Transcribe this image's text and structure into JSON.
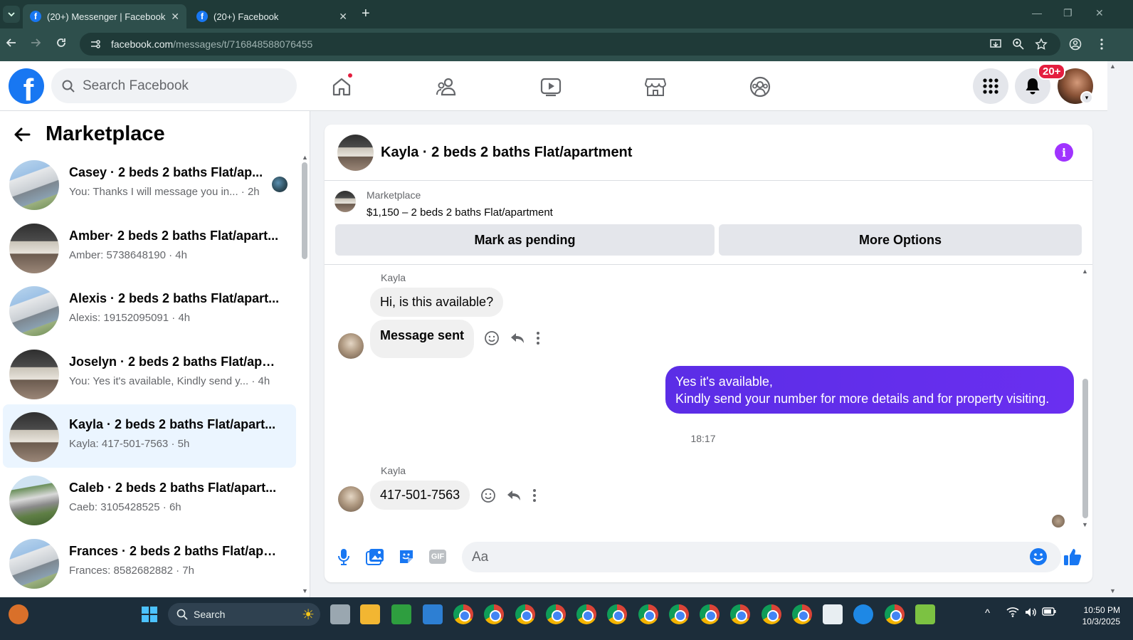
{
  "browser": {
    "tabs": [
      {
        "title": "(20+) Messenger | Facebook",
        "active": true
      },
      {
        "title": "(20+) Facebook",
        "active": false
      }
    ],
    "url_host": "facebook.com",
    "url_path": "/messages/t/716848588076455"
  },
  "fb_header": {
    "logo": "f",
    "search_placeholder": "Search Facebook",
    "notification_badge": "20+",
    "nav_icons": [
      "home-icon",
      "friends-icon",
      "video-icon",
      "marketplace-icon",
      "groups-icon"
    ]
  },
  "sidebar": {
    "title": "Marketplace",
    "conversations": [
      {
        "name": "Casey · 2 beds 2 baths Flat/ap...",
        "preview": "You: Thanks I will message you in... · 2h",
        "thumb": "building",
        "selected": false
      },
      {
        "name": "Amber· 2 beds 2 baths Flat/apart...",
        "preview": "Amber: 5738648190 · 4h",
        "thumb": "interior",
        "selected": false
      },
      {
        "name": "Alexis · 2 beds 2 baths Flat/apart...",
        "preview": "Alexis: 19152095091 · 4h",
        "thumb": "building",
        "selected": false
      },
      {
        "name": "Joselyn · 2 beds 2 baths Flat/apa...",
        "preview": "You: Yes it's available, Kindly send y...  · 4h",
        "thumb": "interior",
        "selected": false
      },
      {
        "name": "Kayla · 2 beds 2 baths Flat/apart...",
        "preview": "Kayla: 417-501-7563 · 5h",
        "thumb": "interior",
        "selected": true
      },
      {
        "name": "Caleb · 2 beds 2 baths Flat/apart...",
        "preview": "Caeb: 3105428525 · 6h",
        "thumb": "house",
        "selected": false
      },
      {
        "name": "Frances · 2 beds 2 baths Flat/apa...",
        "preview": "Frances: 8582682882 · 7h",
        "thumb": "building",
        "selected": false
      }
    ]
  },
  "chat": {
    "title": "Kayla · 2 beds 2 baths Flat/apartment",
    "listing_label": "Marketplace",
    "listing_price": "$1,150 – 2 beds 2 baths Flat/apartment",
    "mark_pending_label": "Mark as pending",
    "more_options_label": "More Options",
    "messages": {
      "sender1": "Kayla",
      "incoming1": "Hi, is this available?",
      "incoming2": "Message sent",
      "outgoing_line1": "Yes it's available,",
      "outgoing_line2": "Kindly send your number for more details and for property visiting.",
      "timestamp": "18:17",
      "sender2": "Kayla",
      "incoming3": "417-501-7563"
    },
    "composer_placeholder": "Aa",
    "gif_label": "GIF"
  },
  "taskbar": {
    "search_label": "Search",
    "time": "10:50 PM",
    "date": "10/3/2025"
  },
  "colors": {
    "fb_blue": "#1877f2",
    "outgoing_bubble": "#5b2de6",
    "info_purple": "#a033ff",
    "badge_red": "#e41e3f"
  }
}
